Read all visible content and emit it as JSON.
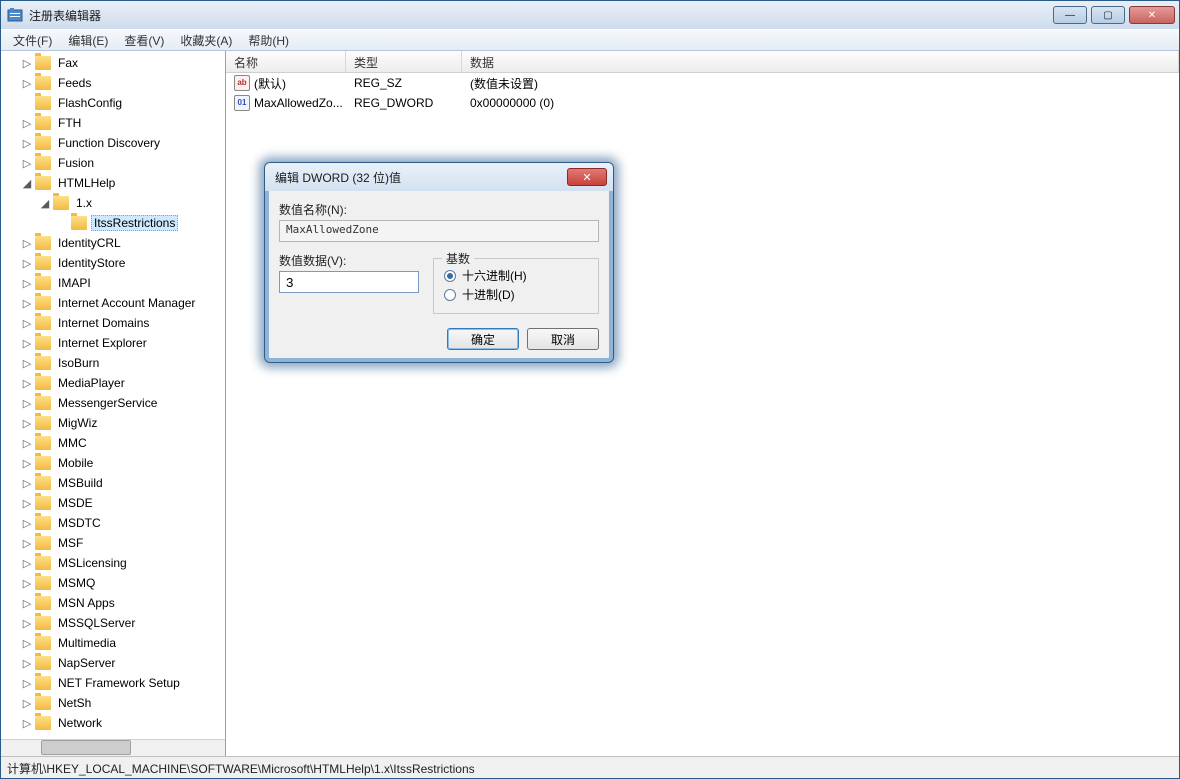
{
  "window": {
    "title": "注册表编辑器"
  },
  "menu": {
    "file": "文件(F)",
    "edit": "编辑(E)",
    "view": "查看(V)",
    "favorites": "收藏夹(A)",
    "help": "帮助(H)"
  },
  "tree": {
    "items": [
      {
        "label": "Fax",
        "depth": 1,
        "exp": "▷"
      },
      {
        "label": "Feeds",
        "depth": 1,
        "exp": "▷"
      },
      {
        "label": "FlashConfig",
        "depth": 1,
        "exp": ""
      },
      {
        "label": "FTH",
        "depth": 1,
        "exp": "▷"
      },
      {
        "label": "Function Discovery",
        "depth": 1,
        "exp": "▷"
      },
      {
        "label": "Fusion",
        "depth": 1,
        "exp": "▷"
      },
      {
        "label": "HTMLHelp",
        "depth": 1,
        "exp": "◢"
      },
      {
        "label": "1.x",
        "depth": 2,
        "exp": "◢"
      },
      {
        "label": "ItssRestrictions",
        "depth": 3,
        "exp": "",
        "selected": true
      },
      {
        "label": "IdentityCRL",
        "depth": 1,
        "exp": "▷"
      },
      {
        "label": "IdentityStore",
        "depth": 1,
        "exp": "▷"
      },
      {
        "label": "IMAPI",
        "depth": 1,
        "exp": "▷"
      },
      {
        "label": "Internet Account Manager",
        "depth": 1,
        "exp": "▷"
      },
      {
        "label": "Internet Domains",
        "depth": 1,
        "exp": "▷"
      },
      {
        "label": "Internet Explorer",
        "depth": 1,
        "exp": "▷"
      },
      {
        "label": "IsoBurn",
        "depth": 1,
        "exp": "▷"
      },
      {
        "label": "MediaPlayer",
        "depth": 1,
        "exp": "▷"
      },
      {
        "label": "MessengerService",
        "depth": 1,
        "exp": "▷"
      },
      {
        "label": "MigWiz",
        "depth": 1,
        "exp": "▷"
      },
      {
        "label": "MMC",
        "depth": 1,
        "exp": "▷"
      },
      {
        "label": "Mobile",
        "depth": 1,
        "exp": "▷"
      },
      {
        "label": "MSBuild",
        "depth": 1,
        "exp": "▷"
      },
      {
        "label": "MSDE",
        "depth": 1,
        "exp": "▷"
      },
      {
        "label": "MSDTC",
        "depth": 1,
        "exp": "▷"
      },
      {
        "label": "MSF",
        "depth": 1,
        "exp": "▷"
      },
      {
        "label": "MSLicensing",
        "depth": 1,
        "exp": "▷"
      },
      {
        "label": "MSMQ",
        "depth": 1,
        "exp": "▷"
      },
      {
        "label": "MSN Apps",
        "depth": 1,
        "exp": "▷"
      },
      {
        "label": "MSSQLServer",
        "depth": 1,
        "exp": "▷"
      },
      {
        "label": "Multimedia",
        "depth": 1,
        "exp": "▷"
      },
      {
        "label": "NapServer",
        "depth": 1,
        "exp": "▷"
      },
      {
        "label": "NET Framework Setup",
        "depth": 1,
        "exp": "▷"
      },
      {
        "label": "NetSh",
        "depth": 1,
        "exp": "▷"
      },
      {
        "label": "Network",
        "depth": 1,
        "exp": "▷"
      }
    ]
  },
  "list": {
    "headers": {
      "name": "名称",
      "type": "类型",
      "data": "数据"
    },
    "rows": [
      {
        "icon": "str",
        "name": "(默认)",
        "type": "REG_SZ",
        "data": "(数值未设置)"
      },
      {
        "icon": "bin",
        "name": "MaxAllowedZo...",
        "type": "REG_DWORD",
        "data": "0x00000000 (0)"
      }
    ]
  },
  "dialog": {
    "title": "编辑 DWORD (32 位)值",
    "name_label": "数值名称(N):",
    "name_value": "MaxAllowedZone",
    "data_label": "数值数据(V):",
    "data_value": "3",
    "base_label": "基数",
    "radio_hex": "十六进制(H)",
    "radio_dec": "十进制(D)",
    "ok": "确定",
    "cancel": "取消"
  },
  "statusbar": {
    "path": "计算机\\HKEY_LOCAL_MACHINE\\SOFTWARE\\Microsoft\\HTMLHelp\\1.x\\ItssRestrictions"
  }
}
